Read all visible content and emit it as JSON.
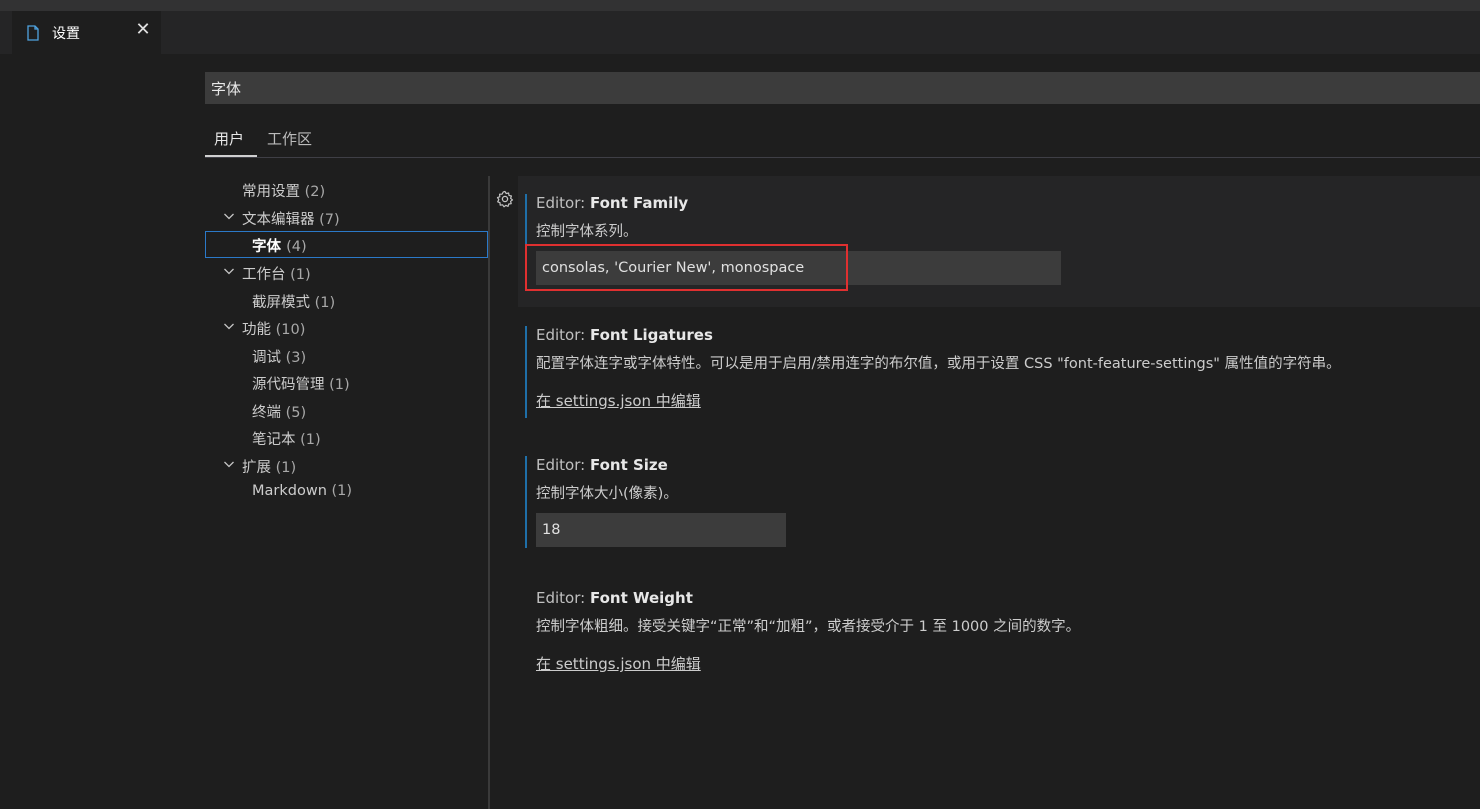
{
  "tab": {
    "title": "设置",
    "icon": "file-icon",
    "close_glyph": "✕"
  },
  "search": {
    "value": "字体"
  },
  "scope_tabs": [
    {
      "label": "用户"
    },
    {
      "label": "工作区"
    }
  ],
  "toc": [
    {
      "label": "常用设置",
      "count": "(2)"
    },
    {
      "label": "文本编辑器",
      "count": "(7)"
    },
    {
      "label": "字体",
      "count": "(4)"
    },
    {
      "label": "工作台",
      "count": "(1)"
    },
    {
      "label": "截屏模式",
      "count": "(1)"
    },
    {
      "label": "功能",
      "count": "(10)"
    },
    {
      "label": "调试",
      "count": "(3)"
    },
    {
      "label": "源代码管理",
      "count": "(1)"
    },
    {
      "label": "终端",
      "count": "(5)"
    },
    {
      "label": "笔记本",
      "count": "(1)"
    },
    {
      "label": "扩展",
      "count": "(1)"
    },
    {
      "label": "Markdown",
      "count": "(1)"
    }
  ],
  "settings": [
    {
      "category": "Editor: ",
      "name": "Font Family",
      "description": "控制字体系列。",
      "value": "consolas, 'Courier New', monospace"
    },
    {
      "category": "Editor: ",
      "name": "Font Ligatures",
      "description": "配置字体连字或字体特性。可以是用于启用/禁用连字的布尔值，或用于设置 CSS \"font-feature-settings\" 属性值的字符串。",
      "link": "在 settings.json 中编辑"
    },
    {
      "category": "Editor: ",
      "name": "Font Size",
      "description": "控制字体大小(像素)。",
      "value": "18"
    },
    {
      "category": "Editor: ",
      "name": "Font Weight",
      "description": "控制字体粗细。接受关键字“正常”和“加粗”，或者接受介于 1 至 1000 之间的数字。",
      "link": "在 settings.json 中编辑"
    }
  ],
  "colors": {
    "accent": "#1f6fa8",
    "highlight": "#e03030",
    "selection_border": "#2b79c8"
  }
}
